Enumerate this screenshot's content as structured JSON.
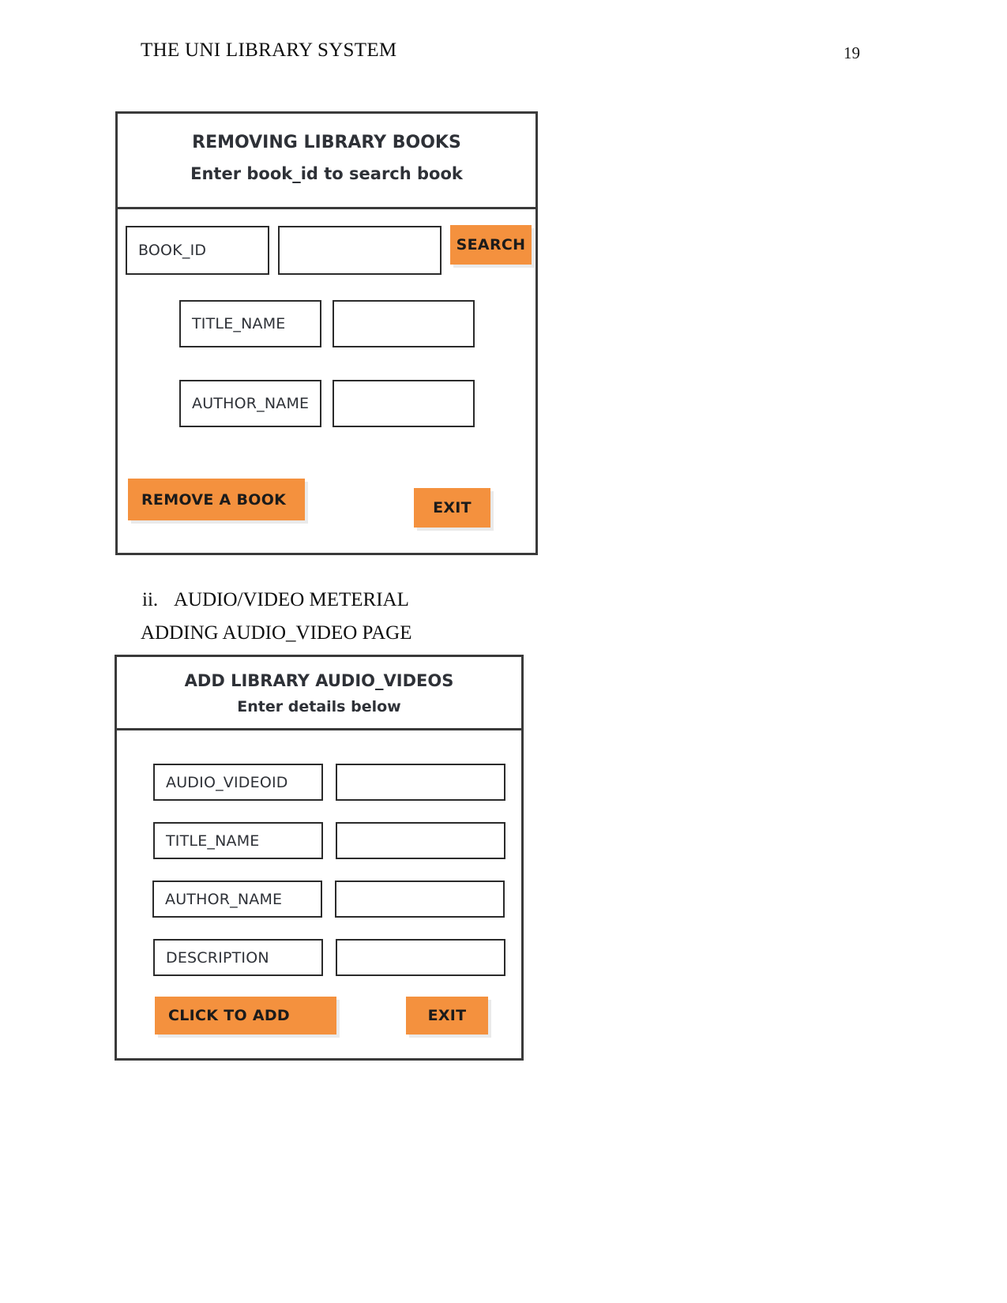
{
  "page": {
    "header_title": "THE UNI LIBRARY SYSTEM",
    "page_number": "19"
  },
  "body_text": {
    "list_marker": "ii.",
    "section_heading": "AUDIO/VIDEO METERIAL",
    "subsection_heading": "ADDING AUDIO_VIDEO PAGE"
  },
  "colors": {
    "button_orange": "#f4913e",
    "border_dark": "#2b2b2b",
    "text_blue_grey": "#2e3137"
  },
  "form_remove_books": {
    "title": "REMOVING  LIBRARY BOOKS",
    "subtitle": "Enter book_id to search book",
    "fields": [
      {
        "label": "BOOK_ID",
        "value": ""
      },
      {
        "label": "TITLE_NAME",
        "value": ""
      },
      {
        "label": "AUTHOR_NAME",
        "value": ""
      }
    ],
    "search_button": "SEARCH",
    "remove_button": "REMOVE A BOOK",
    "exit_button": "EXIT"
  },
  "form_add_audio_video": {
    "title": "ADD LIBRARY AUDIO_VIDEOS",
    "subtitle": "Enter details below",
    "fields": [
      {
        "label": "AUDIO_VIDEOID",
        "value": ""
      },
      {
        "label": "TITLE_NAME",
        "value": ""
      },
      {
        "label": "AUTHOR_NAME",
        "value": ""
      },
      {
        "label": "DESCRIPTION",
        "value": ""
      }
    ],
    "add_button": "CLICK TO ADD",
    "exit_button": "EXIT"
  }
}
